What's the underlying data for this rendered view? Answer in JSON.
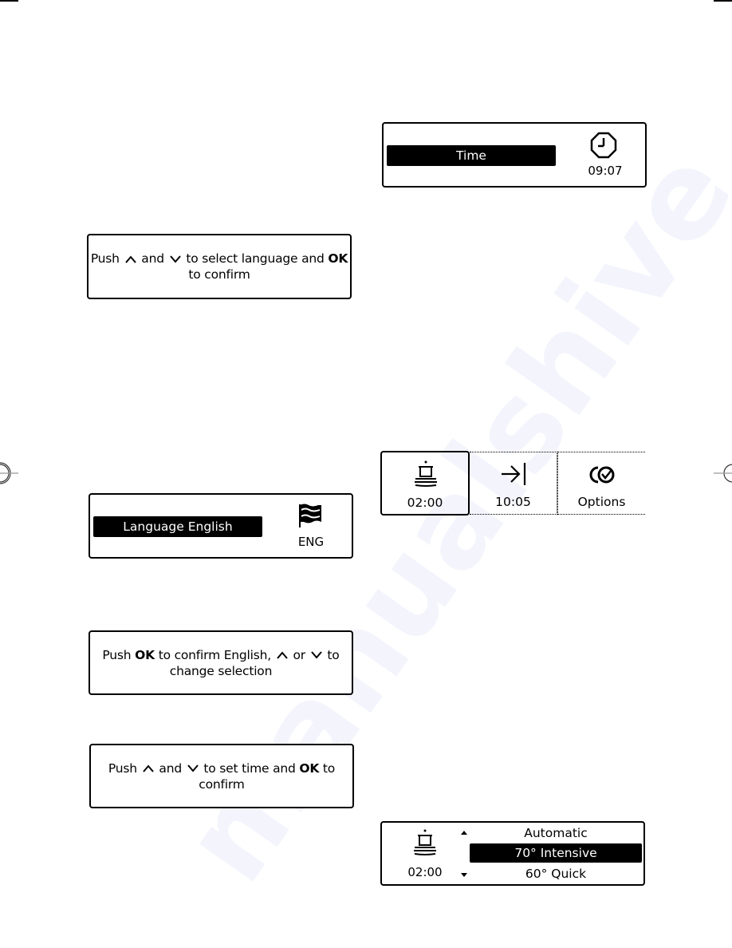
{
  "watermark": "manualshive",
  "panels": {
    "select_language": {
      "line1_pre": "Push",
      "line1_mid1": "and",
      "line1_mid2": "to select language and",
      "line1_bold": "OK",
      "line2": "to confirm"
    },
    "language_display": {
      "selected_label": "Language English",
      "icon": "flag-icon",
      "code": "ENG"
    },
    "confirm_english": {
      "line1_pre": "Push",
      "line1_bold": "OK",
      "line1_mid": "to confirm English,",
      "line1_or": "or",
      "line1_end": "to",
      "line2": "change selection"
    },
    "set_time": {
      "line1_pre": "Push",
      "line1_mid1": "and",
      "line1_mid2": "to set time and",
      "line1_bold": "OK",
      "line1_end": "to",
      "line2": "confirm"
    },
    "time_display": {
      "selected_label": "Time",
      "icon": "clock-icon",
      "value": "09:07"
    },
    "main_menu": {
      "tiles": [
        {
          "icon": "dishwasher-program-icon",
          "label": "02:00",
          "selected": true
        },
        {
          "icon": "end-time-arrow-icon",
          "label": "10:05",
          "selected": false
        },
        {
          "icon": "options-check-icon",
          "label": "Options",
          "selected": false
        }
      ]
    },
    "program_list": {
      "icon": "dishwasher-program-icon",
      "duration": "02:00",
      "items": [
        "Automatic",
        "70° Intensive",
        "60° Quick"
      ],
      "selected_index": 1
    }
  }
}
